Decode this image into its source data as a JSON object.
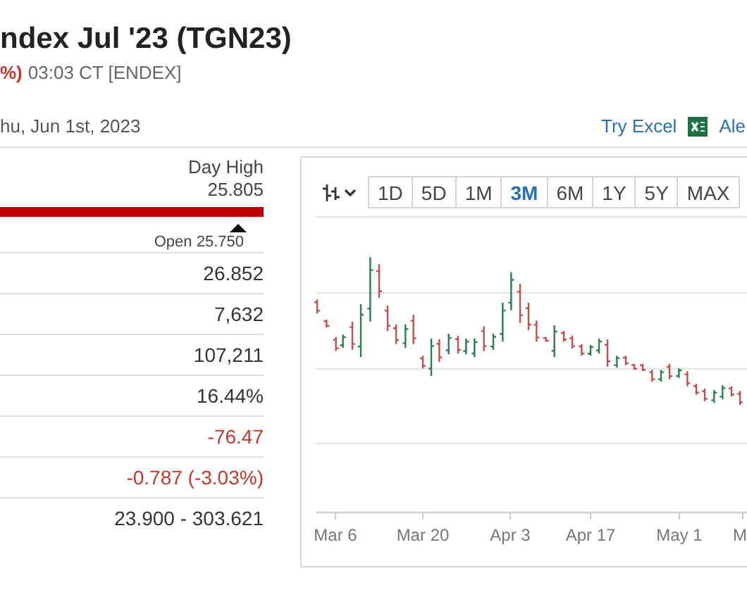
{
  "header": {
    "title": "ndex Jul '23 (TGN23)",
    "change_fragment": "%)",
    "time": "03:03 CT [ENDEX]",
    "date": "hu, Jun 1st, 2023",
    "links": [
      {
        "label": "Try Excel",
        "kind": "excel"
      },
      {
        "label": "Ale",
        "kind": "plain"
      }
    ]
  },
  "day_range": {
    "high_label": "Day High",
    "high_value": "25.805",
    "open_label": "Open 25.750"
  },
  "stats": [
    {
      "value": "26.852",
      "color": "#333333"
    },
    {
      "value": "7,632",
      "color": "#333333"
    },
    {
      "value": "107,211",
      "color": "#333333"
    },
    {
      "value": "16.44%",
      "color": "#333333"
    },
    {
      "value": "-76.47",
      "color": "#c0392b"
    },
    {
      "value": "-0.787 (-3.03%)",
      "color": "#c0392b"
    },
    {
      "value": "23.900 - 303.621",
      "color": "#333333"
    }
  ],
  "chart": {
    "periods": [
      {
        "label": "1D",
        "selected": false
      },
      {
        "label": "5D",
        "selected": false
      },
      {
        "label": "1M",
        "selected": false
      },
      {
        "label": "3M",
        "selected": true
      },
      {
        "label": "6M",
        "selected": false
      },
      {
        "label": "1Y",
        "selected": false
      },
      {
        "label": "5Y",
        "selected": false
      },
      {
        "label": "MAX",
        "selected": false
      }
    ],
    "x_labels": [
      "Mar 6",
      "Mar 20",
      "Apr 3",
      "Apr 17",
      "May 1",
      "M"
    ]
  }
}
